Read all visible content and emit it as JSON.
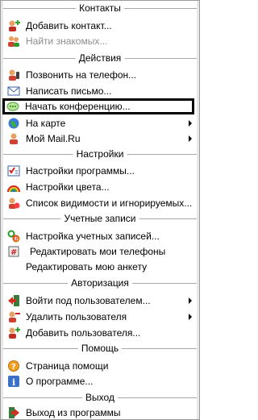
{
  "sections": {
    "contacts": "Контакты",
    "actions": "Действия",
    "settings": "Настройки",
    "accounts": "Учетные записи",
    "auth": "Авторизация",
    "help": "Помощь",
    "exit": "Выход"
  },
  "items": {
    "add_contact": "Добавить контакт...",
    "find_friends": "Найти знакомых...",
    "call_phone": "Позвонить на телефон...",
    "write_letter": "Написать письмо...",
    "start_conference": "Начать конференцию...",
    "on_map": "На карте",
    "my_mailru": "Мой Mail.Ru",
    "program_settings": "Настройки программы...",
    "color_settings": "Настройки цвета...",
    "visibility_list": "Список видимости и игнорируемых...",
    "account_setup": "Настройка учетных записей...",
    "edit_phones": "Редактировать мои телефоны",
    "edit_profile": "Редактировать мою анкету",
    "login_as": "Войти под пользователем...",
    "delete_user": "Удалить пользователя",
    "add_user": "Добавить пользователя...",
    "help_page": "Страница помощи",
    "about": "О программе...",
    "quit": "Выход из программы"
  }
}
